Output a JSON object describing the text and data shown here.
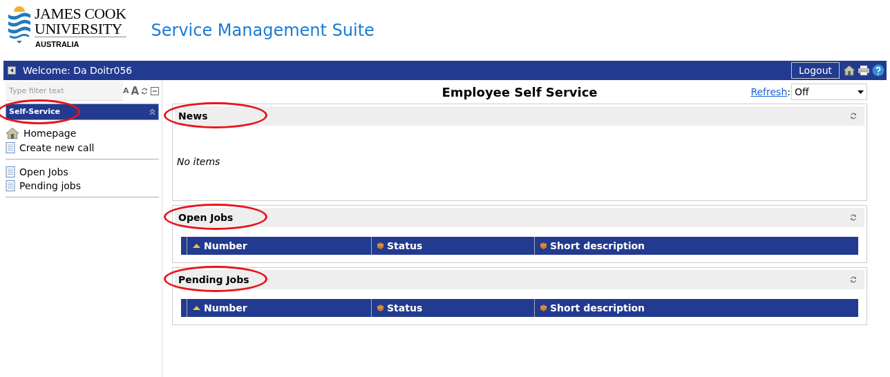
{
  "header": {
    "logo": {
      "line1": "JAMES COOK",
      "line2": "UNIVERSITY",
      "line3": "AUSTRALIA"
    },
    "title": "Service Management Suite"
  },
  "topbar": {
    "welcome": "Welcome: Da Doitr056",
    "logout": "Logout"
  },
  "sidebar": {
    "filter_placeholder": "Type filter text",
    "font_small": "A",
    "font_large": "A",
    "group": {
      "title": "Self-Service",
      "highlighted": true
    },
    "sections": [
      [
        {
          "label": "Homepage",
          "kind": "home"
        },
        {
          "label": "Create new call",
          "kind": "page"
        }
      ],
      [
        {
          "label": "Open Jobs",
          "kind": "page"
        },
        {
          "label": "Pending jobs",
          "kind": "page"
        }
      ]
    ]
  },
  "main": {
    "title": "Employee Self Service",
    "refresh_label": "Refresh",
    "refresh_separator": ":",
    "refresh_value": "Off",
    "panels": [
      {
        "title": "News",
        "highlighted": true,
        "kind": "text",
        "text": "No items"
      },
      {
        "title": "Open Jobs",
        "highlighted": true,
        "kind": "table",
        "columns": [
          {
            "label": "Number",
            "sorted": true
          },
          {
            "label": "Status",
            "sorted": false
          },
          {
            "label": "Short description",
            "sorted": false
          }
        ]
      },
      {
        "title": "Pending Jobs",
        "highlighted": true,
        "kind": "table",
        "columns": [
          {
            "label": "Number",
            "sorted": true
          },
          {
            "label": "Status",
            "sorted": false
          },
          {
            "label": "Short description",
            "sorted": false
          }
        ]
      }
    ]
  }
}
